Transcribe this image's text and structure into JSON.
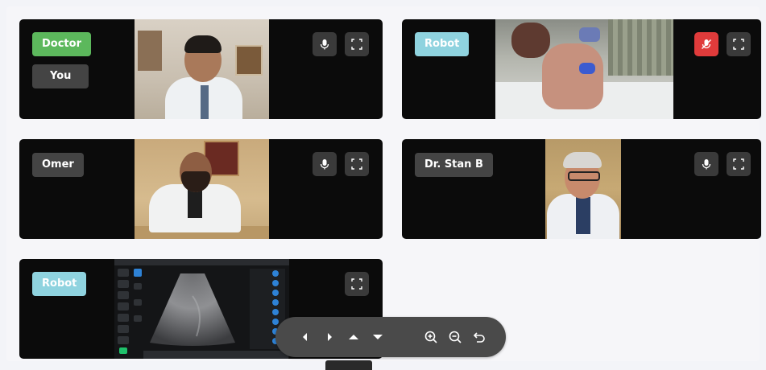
{
  "participants": [
    {
      "id": "doctor",
      "badge_primary": "Doctor",
      "badge_secondary": "You",
      "mic": "on",
      "badge_color": "#5cb85c"
    },
    {
      "id": "robot-cam",
      "badge_primary": "Robot",
      "mic": "muted",
      "badge_color": "#8fd3df"
    },
    {
      "id": "omer",
      "badge_primary": "Omer",
      "mic": "on",
      "badge_color": "#444444"
    },
    {
      "id": "stan",
      "badge_primary": "Dr. Stan B",
      "mic": "on",
      "badge_color": "#444444"
    },
    {
      "id": "robot-us",
      "badge_primary": "Robot",
      "badge_color": "#8fd3df"
    }
  ],
  "icons": {
    "mic": "mic-icon",
    "mic_muted": "mic-off-icon",
    "fullscreen": "fullscreen-icon"
  },
  "toolbar": {
    "buttons": [
      "arrow-left-icon",
      "arrow-right-icon",
      "arrow-up-icon",
      "arrow-down-icon",
      "zoom-in-icon",
      "zoom-out-icon",
      "undo-icon"
    ]
  },
  "colors": {
    "muted_button": "#e03b3b",
    "control_button": "#3a3a3a",
    "ultrasound_accent": "#2e82d6",
    "ultrasound_highlight": "#1fc16b"
  }
}
